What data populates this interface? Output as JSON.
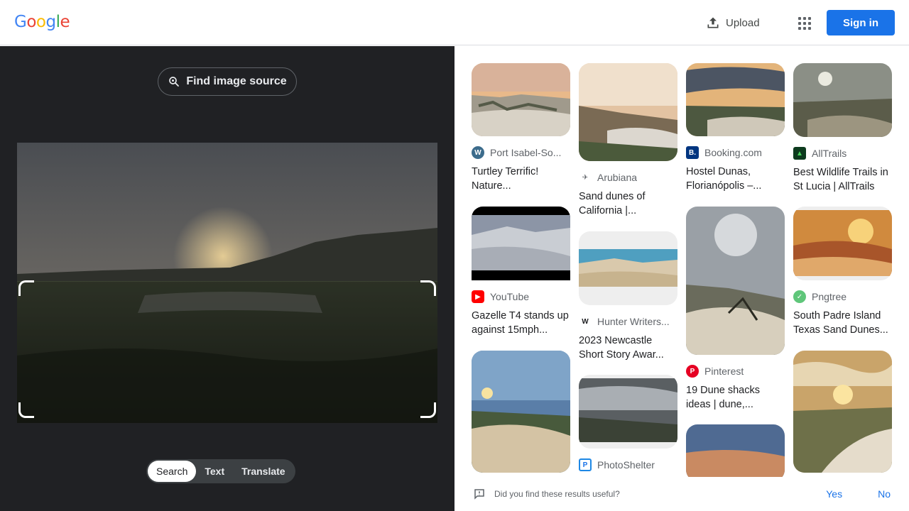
{
  "header": {
    "logo": [
      "G",
      "o",
      "o",
      "g",
      "l",
      "e"
    ],
    "upload_label": "Upload",
    "signin_label": "Sign in"
  },
  "viewer": {
    "find_source_label": "Find image source",
    "tabs": [
      "Search",
      "Text",
      "Translate"
    ],
    "active_tab": "Search"
  },
  "results": [
    {
      "source": "Port Isabel-So...",
      "title": "Turtley Terrific! Nature..."
    },
    {
      "source": "YouTube",
      "title": "Gazelle T4 stands up against 15mph..."
    },
    {
      "source": "Arubiana",
      "title": "Sand dunes of California |..."
    },
    {
      "source": "Hunter Writers...",
      "title": "2023 Newcastle Short Story Awar..."
    },
    {
      "source": "PhotoShelter",
      "title": ""
    },
    {
      "source": "Booking.com",
      "title": "Hostel Dunas, Florianópolis –..."
    },
    {
      "source": "Pinterest",
      "title": "19 Dune shacks ideas | dune,..."
    },
    {
      "source": "AllTrails",
      "title": "Best Wildlife Trails in St Lucia | AllTrails"
    },
    {
      "source": "Pngtree",
      "title": "South Padre Island Texas Sand Dunes..."
    }
  ],
  "feedback": {
    "question": "Did you find these results useful?",
    "yes": "Yes",
    "no": "No"
  },
  "colors": {
    "accent": "#1a73e8",
    "dark_panel": "#202124"
  }
}
